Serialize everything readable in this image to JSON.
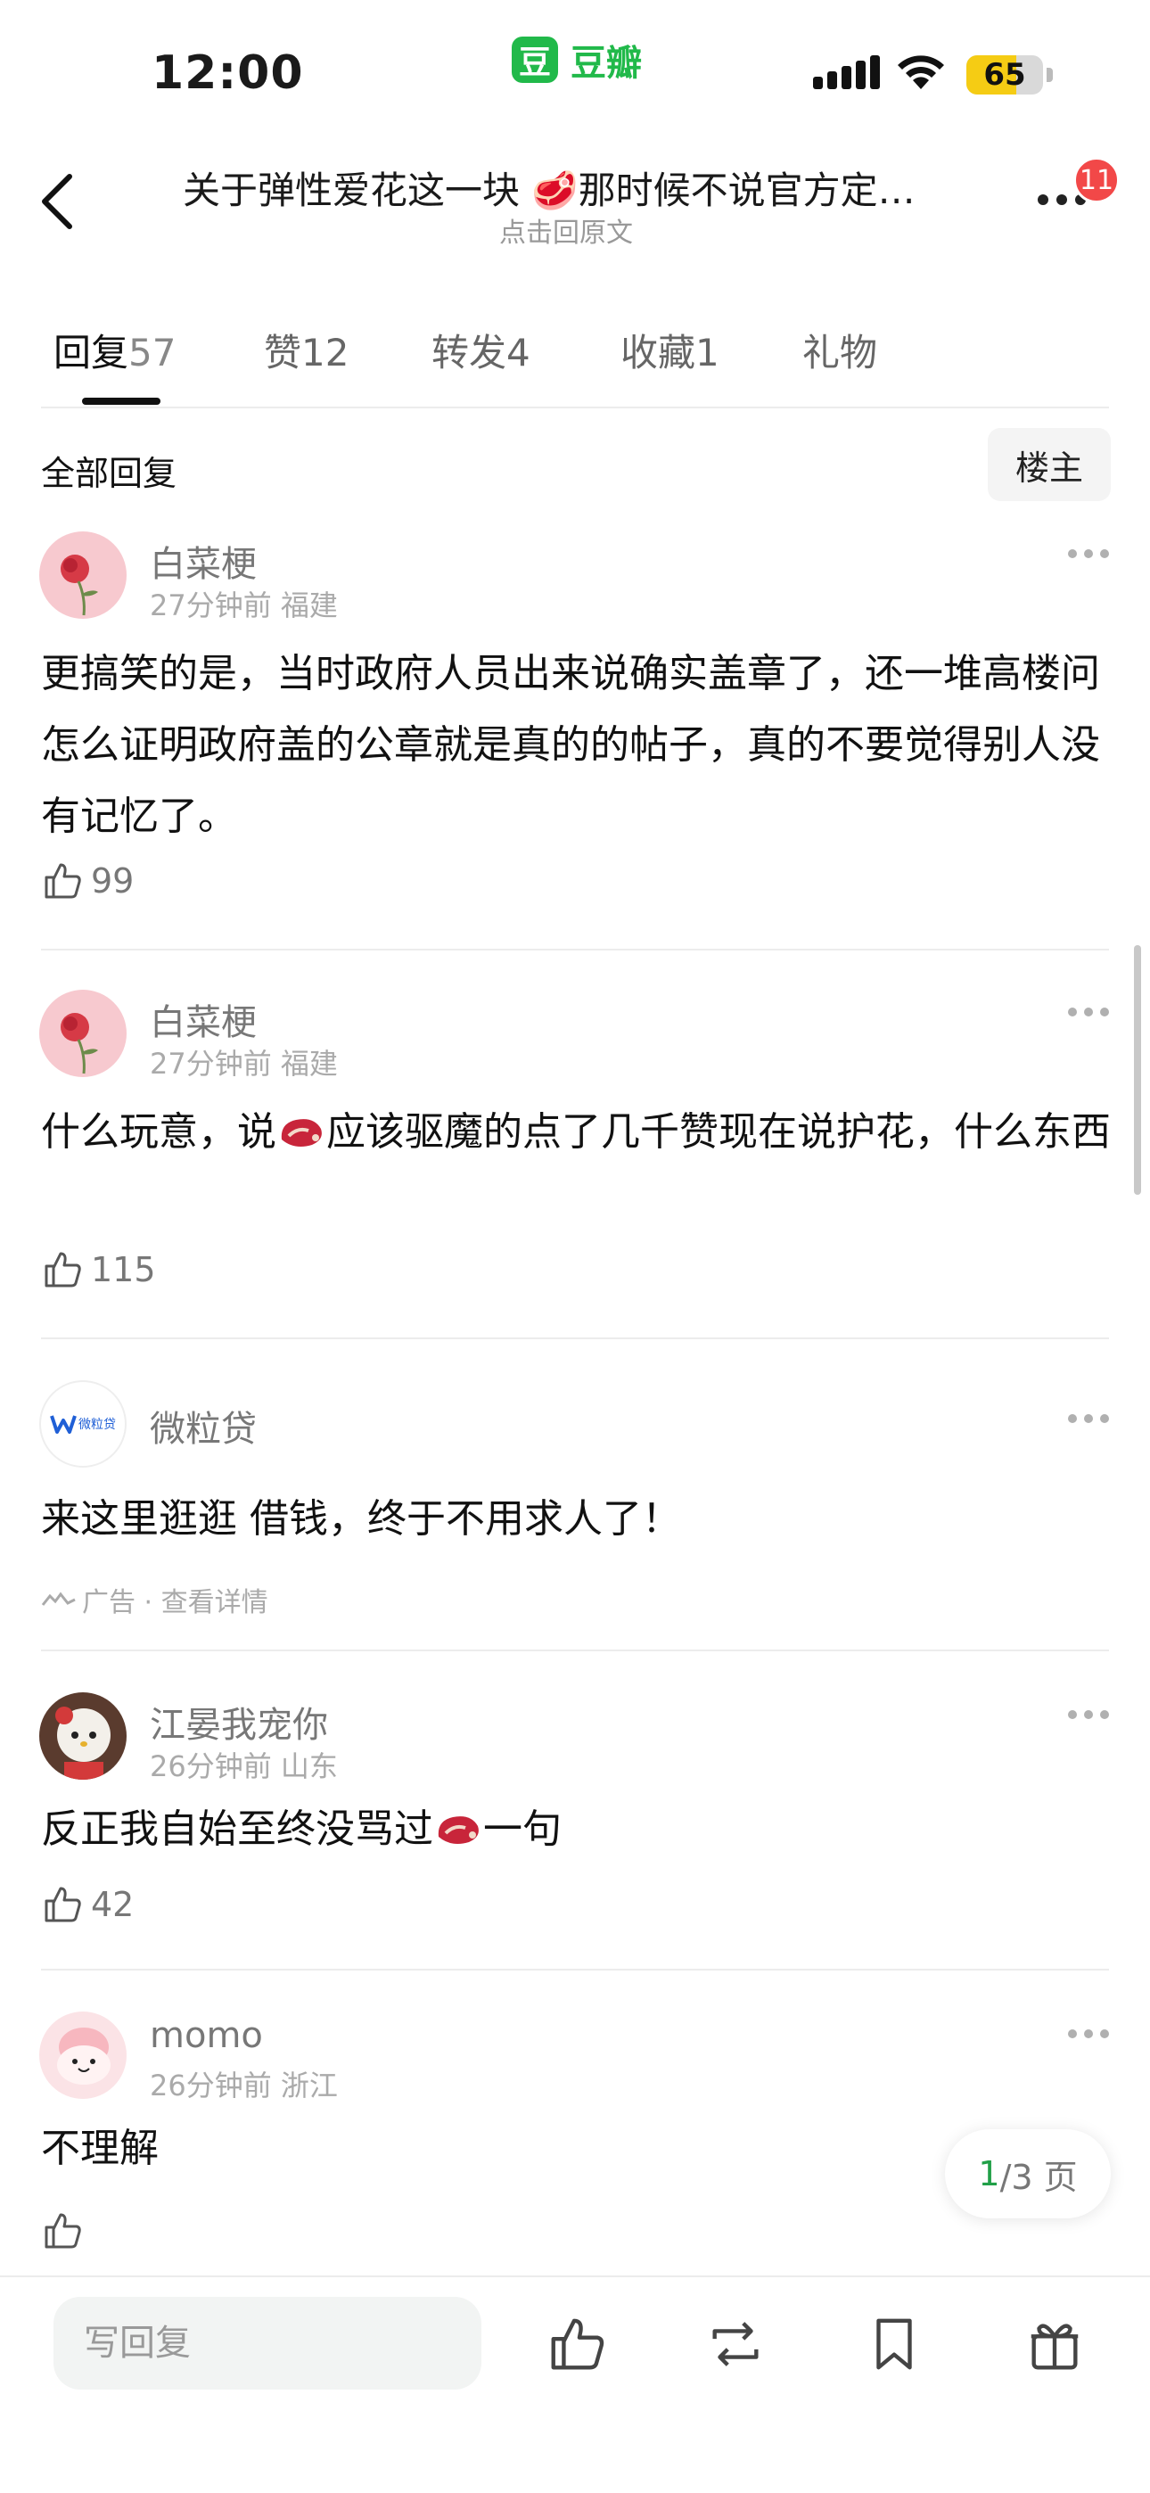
{
  "status_bar": {
    "time": "12:00",
    "app_logo_char": "豆",
    "app_name": "豆瓣",
    "battery_percent": "65",
    "battery_color": "#f5cc14"
  },
  "header": {
    "title": "关于弹性爱花这一块 🥩那时候不说官方定…",
    "subtitle": "点击回原文",
    "notification_count": "11"
  },
  "tabs": [
    {
      "label": "回复",
      "count": "57",
      "active": true
    },
    {
      "label": "赞",
      "count": "12",
      "active": false
    },
    {
      "label": "转发",
      "count": "4",
      "active": false
    },
    {
      "label": "收藏",
      "count": "1",
      "active": false
    },
    {
      "label": "礼物",
      "count": "",
      "active": false
    }
  ],
  "section": {
    "title": "全部回复",
    "owner_filter": "楼主"
  },
  "comments": [
    {
      "username": "白菜梗",
      "meta": "27分钟前 福建",
      "text": "更搞笑的是，当时政府人员出来说确实盖章了，还一堆高楼问怎么证明政府盖的公章就是真的的帖子，真的不要觉得别人没有记忆了。",
      "likes": "99"
    },
    {
      "username": "白菜梗",
      "meta": "27分钟前 福建",
      "text_before": "什么玩意，说",
      "text_after": "应该驱魔的点了几千赞现在说护花，什么东西",
      "likes": "115"
    },
    {
      "username": "江晏我宠你",
      "meta": "26分钟前 山东",
      "text_before": "反正我自始至终没骂过",
      "text_after": "一句",
      "likes": "42"
    },
    {
      "username": "momo",
      "meta": "26分钟前 浙江",
      "text": "不理解",
      "likes": ""
    }
  ],
  "ad": {
    "name": "微粒贷",
    "logo_text": "微粒贷",
    "text": "来这里逛逛 借钱，终于不用求人了！",
    "label": "广告 · 查看详情"
  },
  "pagination": {
    "current": "1",
    "total_suffix": "/3 页"
  },
  "bottom_bar": {
    "reply_placeholder": "写回复"
  },
  "colors": {
    "brand_green": "#21b94a",
    "badge_red": "#f24848"
  }
}
